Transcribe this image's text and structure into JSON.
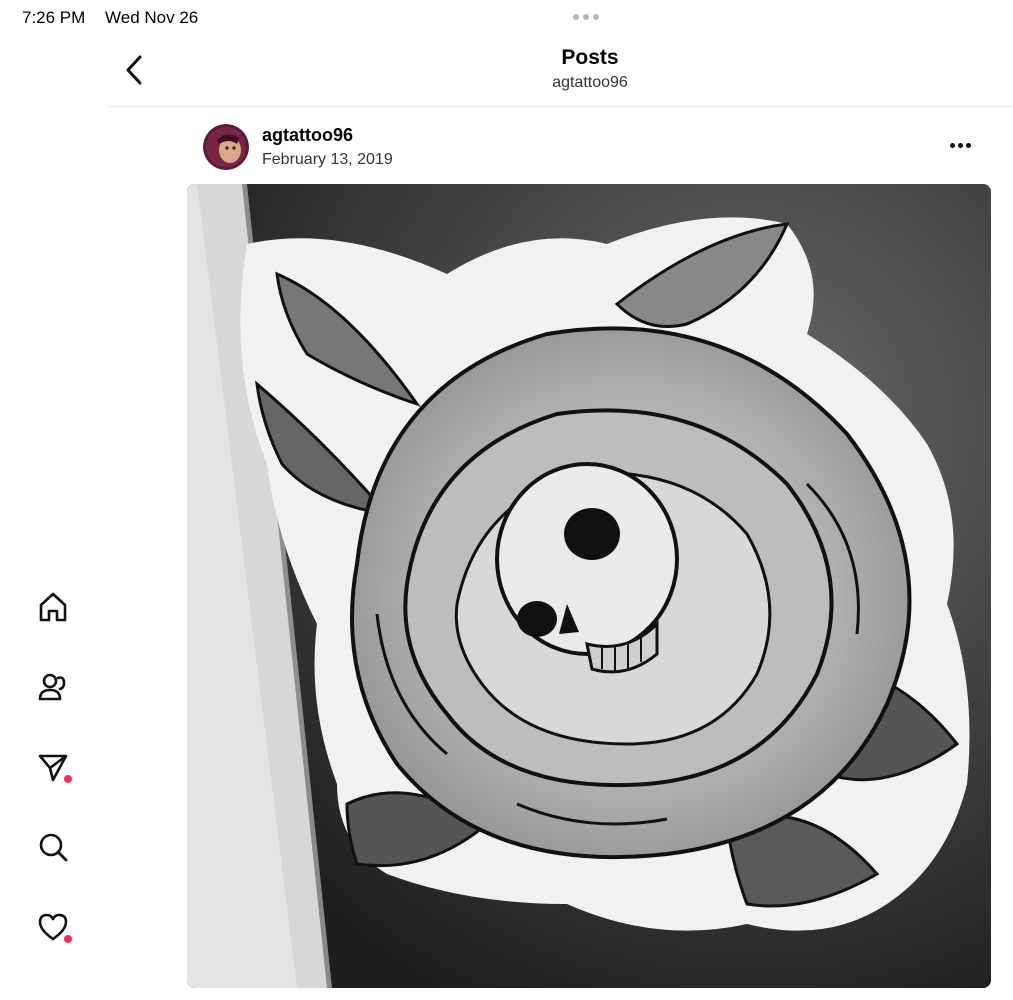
{
  "status_bar": {
    "time": "7:26 PM",
    "date": "Wed Nov 26"
  },
  "header": {
    "title": "Posts",
    "subtitle": "agtattoo96"
  },
  "post": {
    "username": "agtattoo96",
    "date": "February 13, 2019",
    "image_icon": "rose-skull-tattoo-drawing"
  },
  "nav": {
    "items": [
      "home-icon",
      "people-icon",
      "send-icon",
      "search-icon",
      "heart-icon"
    ],
    "notification_color": "#ff2d55"
  }
}
